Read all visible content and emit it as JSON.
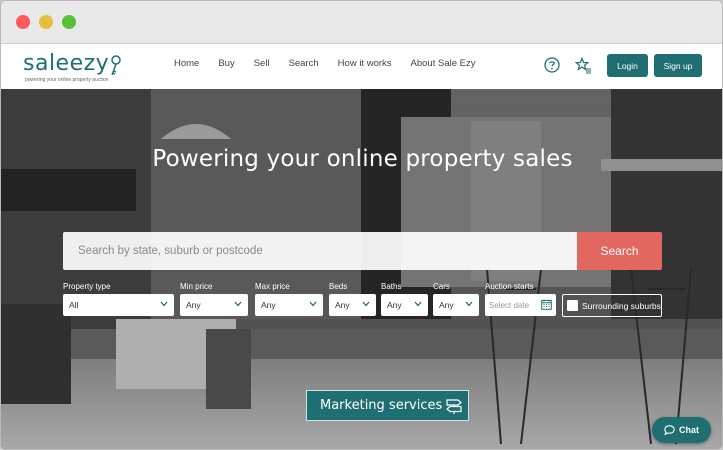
{
  "browser": {
    "dots": {
      "close": "#fc5b57",
      "minimize": "#e5bf3c",
      "maximize": "#57c038"
    }
  },
  "brand": {
    "logo_text": "saleezy",
    "tagline": "powering your online property auction",
    "color": "#1f6e72"
  },
  "nav": {
    "links": [
      "Home",
      "Buy",
      "Sell",
      "Search",
      "How it works",
      "About Sale Ezy"
    ],
    "help_icon": "question-circle-icon",
    "favorites_icon": "star-list-icon",
    "login_label": "Login",
    "signup_label": "Sign up"
  },
  "hero": {
    "title": "Powering your online property sales",
    "search": {
      "placeholder": "Search by state, suburb or postcode",
      "button_label": "Search",
      "button_color": "#e2675e"
    },
    "filters": {
      "property_type": {
        "label": "Property type",
        "value": "All"
      },
      "min_price": {
        "label": "Min price",
        "value": "Any"
      },
      "max_price": {
        "label": "Max price",
        "value": "Any"
      },
      "beds": {
        "label": "Beds",
        "value": "Any"
      },
      "baths": {
        "label": "Baths",
        "value": "Any"
      },
      "cars": {
        "label": "Cars",
        "value": "Any"
      },
      "auction_starts": {
        "label": "Auction starts",
        "placeholder": "Select date"
      }
    },
    "surrounding_suburbs": {
      "label": "Surrounding suburbs",
      "checked": false
    },
    "marketing_label": "Marketing services"
  },
  "chat": {
    "label": "Chat"
  }
}
